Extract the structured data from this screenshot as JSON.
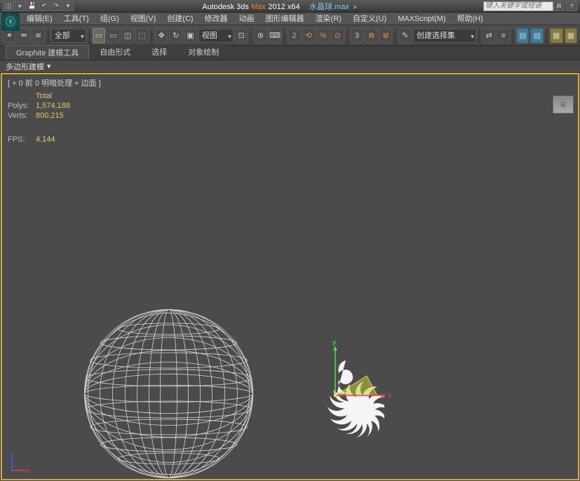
{
  "titlebar": {
    "app": "Autodesk 3ds",
    "product": "Max",
    "version": "2012 x64",
    "filename": "水晶球.max",
    "search_placeholder": "键入关键字或短语"
  },
  "menu": [
    "编辑(E)",
    "工具(T)",
    "组(G)",
    "视图(V)",
    "创建(C)",
    "修改器",
    "动画",
    "图形编辑器",
    "渲染(R)",
    "自定义(U)",
    "MAXScript(M)",
    "帮助(H)"
  ],
  "toolbar": {
    "selection_filter": "全部",
    "view_dropdown": "视图",
    "right_dropdown": "创建选择集"
  },
  "ribbon": {
    "tabs": [
      "Graphite 建模工具",
      "自由形式",
      "选择",
      "对象绘制"
    ],
    "sub": "多边形建模"
  },
  "viewport": {
    "label": "[ + 0 前 0 明暗处理 + 边面 ]",
    "stats": {
      "total_label": "Total",
      "polys_label": "Polys:",
      "polys_value": "1,574,188",
      "verts_label": "Verts:",
      "verts_value": "800,215",
      "fps_label": "FPS:",
      "fps_value": "4.144"
    },
    "gizmo": {
      "x": "x",
      "y": "y",
      "z": "z"
    },
    "viewcube": "前"
  }
}
